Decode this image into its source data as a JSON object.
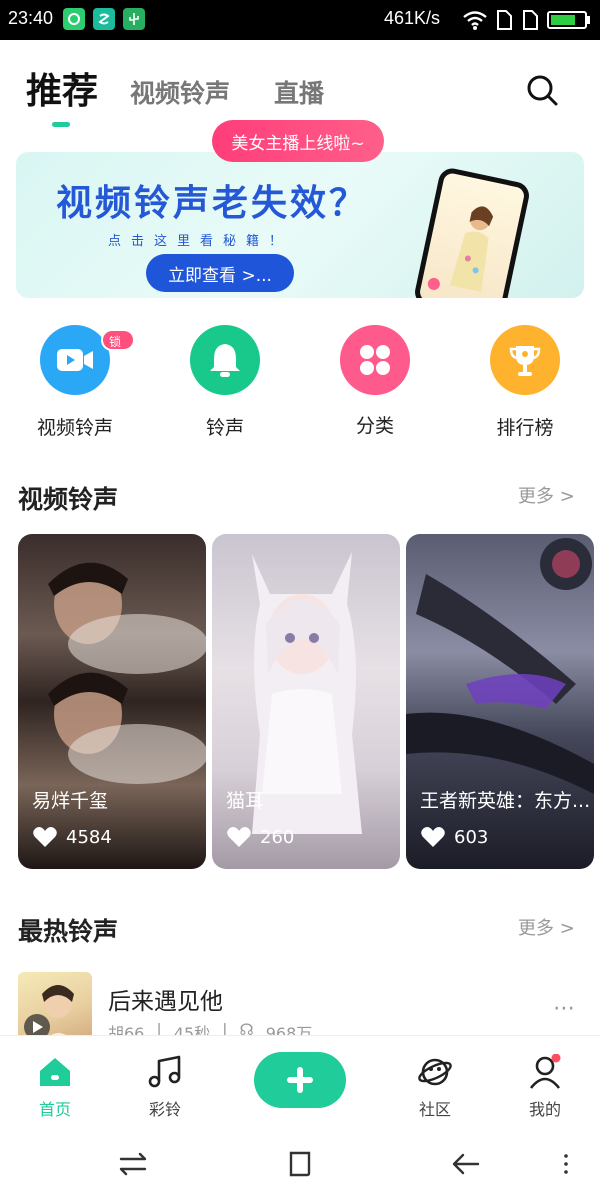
{
  "status_bar": {
    "time": "23:40",
    "network_speed": "461K/s",
    "battery_level": 0.75,
    "icons": [
      "app-notification-icon",
      "app-notification-icon",
      "usb-icon",
      "wifi-icon",
      "sim-icon",
      "sim-icon",
      "battery-icon"
    ]
  },
  "tabs": {
    "items": [
      "推荐",
      "视频铃声",
      "直播"
    ],
    "active_index": 0
  },
  "live_pill": "美女主播上线啦~",
  "banner": {
    "title": "视频铃声老失效？",
    "subtitle": "点击这里看秘籍！",
    "button": "立即查看 >..."
  },
  "quick_entries": [
    {
      "label": "视频铃声",
      "icon": "video-camera-icon",
      "color": "#2aa8f5",
      "badge": "锁屏壁纸"
    },
    {
      "label": "铃声",
      "icon": "bell-icon",
      "color": "#19c98c"
    },
    {
      "label": "分类",
      "icon": "grid-icon",
      "color": "#ff5a8c"
    },
    {
      "label": "排行榜",
      "icon": "trophy-icon",
      "color": "#ffb22d"
    }
  ],
  "video_section": {
    "title": "视频铃声",
    "more": "更多 >",
    "cards": [
      {
        "title": "易烊千玺",
        "likes": "4584"
      },
      {
        "title": "猫耳",
        "likes": "260"
      },
      {
        "title": "王者新英雄：东方...",
        "likes": "603"
      }
    ]
  },
  "hot_section": {
    "title": "最热铃声",
    "more": "更多 >",
    "songs": [
      {
        "title": "后来遇见他",
        "artist": "胡66",
        "duration": "45秒",
        "plays": "968万"
      }
    ]
  },
  "bottom_nav": [
    {
      "label": "首页",
      "icon": "home-icon",
      "active": true
    },
    {
      "label": "彩铃",
      "icon": "music-note-icon",
      "active": false
    },
    {
      "label": "",
      "icon": "plus-icon",
      "active": false
    },
    {
      "label": "社区",
      "icon": "planet-icon",
      "active": false
    },
    {
      "label": "我的",
      "icon": "profile-icon",
      "active": false
    }
  ],
  "colors": {
    "accent": "#1fcc9a",
    "banner_blue": "#2458d6",
    "pink": "#ff4f7d"
  }
}
